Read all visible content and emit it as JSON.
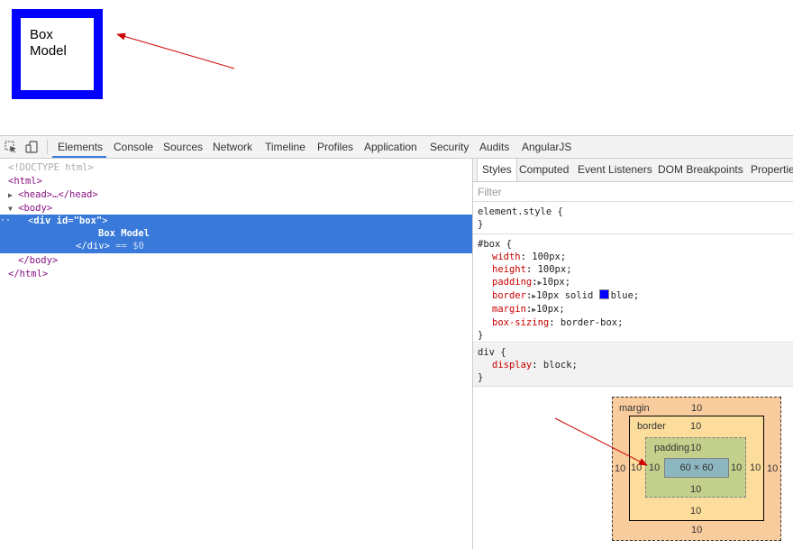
{
  "demo": {
    "line1": "Box",
    "line2": "Model"
  },
  "toolbar": {
    "tabs": [
      "Elements",
      "Console",
      "Sources",
      "Network",
      "Timeline",
      "Profiles",
      "Application",
      "Security",
      "Audits",
      "AngularJS"
    ],
    "active_tab": "Elements",
    "icons": [
      "inspect-element-icon",
      "device-mode-icon"
    ]
  },
  "dom": {
    "doctype": "<!DOCTYPE html>",
    "html_open": "<html>",
    "head": "<head>…</head>",
    "body_open": "<body>",
    "div_tag": "div",
    "div_attr_name": "id",
    "div_attr_value": "\"box\"",
    "div_text": "Box Model",
    "div_close": "</div>",
    "dollar_zero": "== $0",
    "body_close": "</body>",
    "html_close": "</html>"
  },
  "sidebar": {
    "tabs": [
      "Styles",
      "Computed",
      "Event Listeners",
      "DOM Breakpoints",
      "Properties"
    ],
    "active_tab": "Styles",
    "filter_placeholder": "Filter",
    "rules": {
      "element_style": {
        "selector": "element.style {",
        "close": "}"
      },
      "box": {
        "selector": "#box {",
        "props": [
          {
            "name": "width",
            "value": "100px;"
          },
          {
            "name": "height",
            "value": "100px;"
          },
          {
            "name": "padding",
            "value": "10px;",
            "expandable": true
          },
          {
            "name": "border",
            "value": "10px solid",
            "expandable": true,
            "color_swatch": "#0000ff",
            "tail": "blue;"
          },
          {
            "name": "margin",
            "value": "10px;",
            "expandable": true
          },
          {
            "name": "box-sizing",
            "value": "border-box;"
          }
        ],
        "close": "}"
      },
      "div": {
        "selector": "div {",
        "props": [
          {
            "name": "display",
            "value": "block;"
          }
        ],
        "close": "}"
      }
    }
  },
  "box_model": {
    "margin_label": "margin",
    "border_label": "border",
    "padding_label": "padding",
    "margin": {
      "top": "10",
      "right": "10",
      "bottom": "10",
      "left": "10"
    },
    "border": {
      "top": "10",
      "right": "10",
      "bottom": "10",
      "left": "10"
    },
    "padding": {
      "top": "10",
      "right": "10",
      "bottom": "10",
      "left": "10"
    },
    "content": "60 × 60"
  },
  "colors": {
    "selection": "#3879d9",
    "border_blue": "#0000ff",
    "annotation_arrow": "#cc0000"
  }
}
